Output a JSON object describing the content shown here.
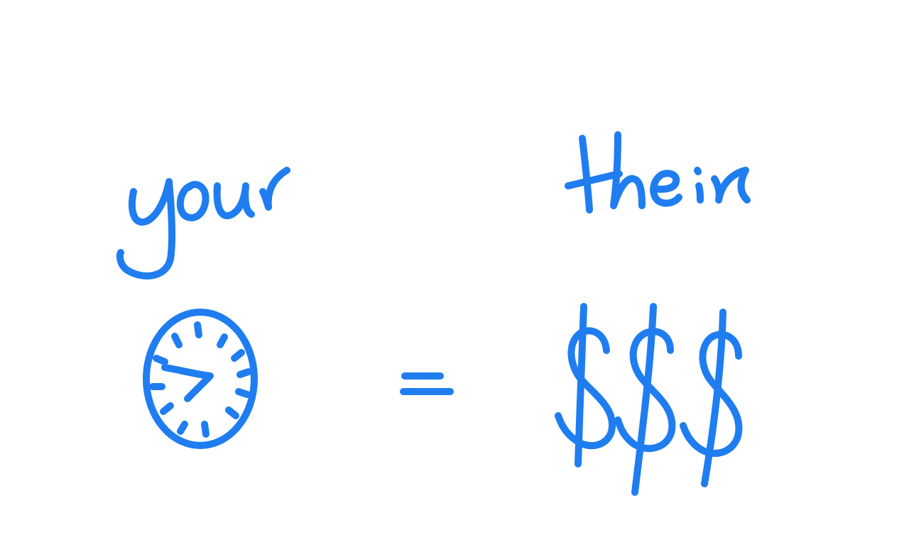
{
  "canvas": {
    "background": "#ffffff",
    "ink_color": "#1f7df0"
  },
  "sketch": {
    "left_word": "your",
    "right_word": "their",
    "left_symbol": "clock-icon",
    "operator": "=",
    "right_symbol": "$$$"
  }
}
